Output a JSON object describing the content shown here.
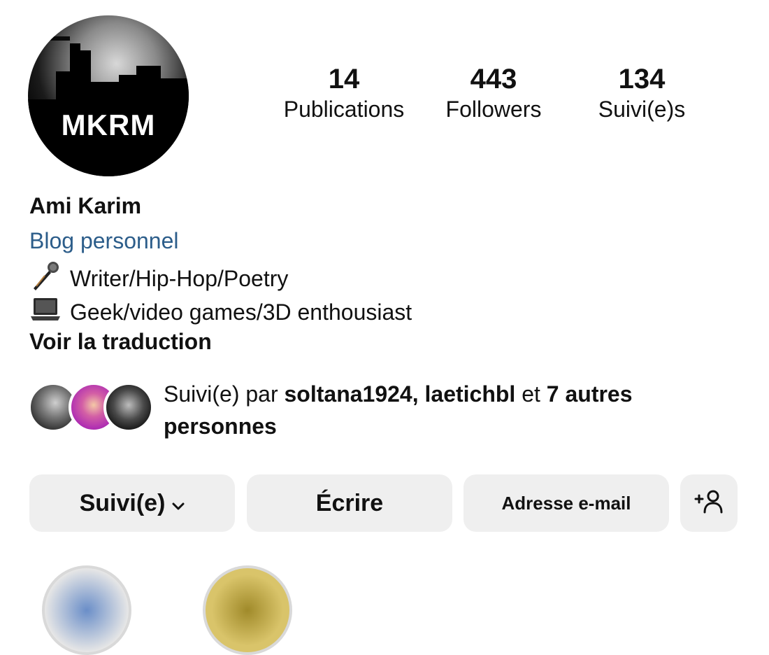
{
  "profile": {
    "avatar_text": "MKRM",
    "stats": [
      {
        "value": "14",
        "label": "Publications"
      },
      {
        "value": "443",
        "label": "Followers"
      },
      {
        "value": "134",
        "label": "Suivi(e)s"
      }
    ],
    "name": "Ami Karim",
    "category": "Blog personnel",
    "bio": [
      {
        "icon": "microphone-icon",
        "text": "Writer/Hip-Hop/Poetry"
      },
      {
        "icon": "laptop-icon",
        "text": "Geek/video games/3D enthousiast"
      }
    ],
    "translate_label": "Voir la traduction"
  },
  "followed_by": {
    "prefix": "Suivi(e) par ",
    "user1": "soltana1924",
    "sep": ", ",
    "user2": "laetichbl",
    "mid": " et ",
    "others": "7 autres personnes"
  },
  "actions": {
    "following_label": "Suivi(e)",
    "message_label": "Écrire",
    "email_label": "Adresse e-mail",
    "add_user_icon": "add-person-icon"
  },
  "colors": {
    "category_link": "#2c5d8a",
    "button_bg": "#efefef"
  }
}
